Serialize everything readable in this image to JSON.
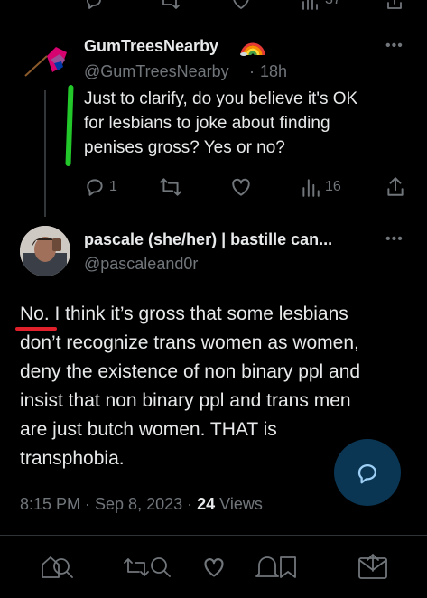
{
  "top_action_bar": {
    "icons": [
      "reply-icon",
      "retweet-icon",
      "like-icon",
      "views-icon",
      "share-icon"
    ],
    "views_partial": "37"
  },
  "reply_tweet": {
    "display_name": "GumTreesNearby",
    "name_emoji": "rainbow",
    "handle": "@GumTreesNearby",
    "separator": "·",
    "time": "18h",
    "more": "•••",
    "text_lines": [
      "Just to clarify, do you believe it's OK",
      "for lesbians to joke about finding",
      "penises gross? Yes or no?"
    ],
    "actions": {
      "reply_count": "1",
      "retweet_count": "",
      "like_count": "",
      "views_count": "16"
    }
  },
  "main_tweet": {
    "display_name": "pascale (she/her) | bastille can...",
    "handle": "@pascaleand0r",
    "more": "•••",
    "text_lines": [
      "No. I think it’s gross that some lesbians",
      "don’t recognize trans women as women,",
      "deny the existence of non binary ppl and",
      "insist that non binary ppl and trans men",
      "are just butch women.  THAT is",
      "transphobia."
    ],
    "timestamp": "8:15 PM · Sep 8, 2023 · ",
    "views_count": "24",
    "views_label": " Views"
  },
  "annotations": {
    "green_mark_color": "#22c72a",
    "red_underline_color": "#e0202a"
  },
  "fab": {
    "icon": "compose-reply-icon",
    "color": "#1d9bf0"
  },
  "colors": {
    "background": "#000000",
    "text": "#e7e9ea",
    "muted": "#71767b",
    "divider": "#2f3336",
    "thread_line": "#333639"
  },
  "bottom_nav": {
    "items": [
      "home-search-icon",
      "retweet-search-icon",
      "notifications-icon",
      "messages-icon"
    ]
  }
}
